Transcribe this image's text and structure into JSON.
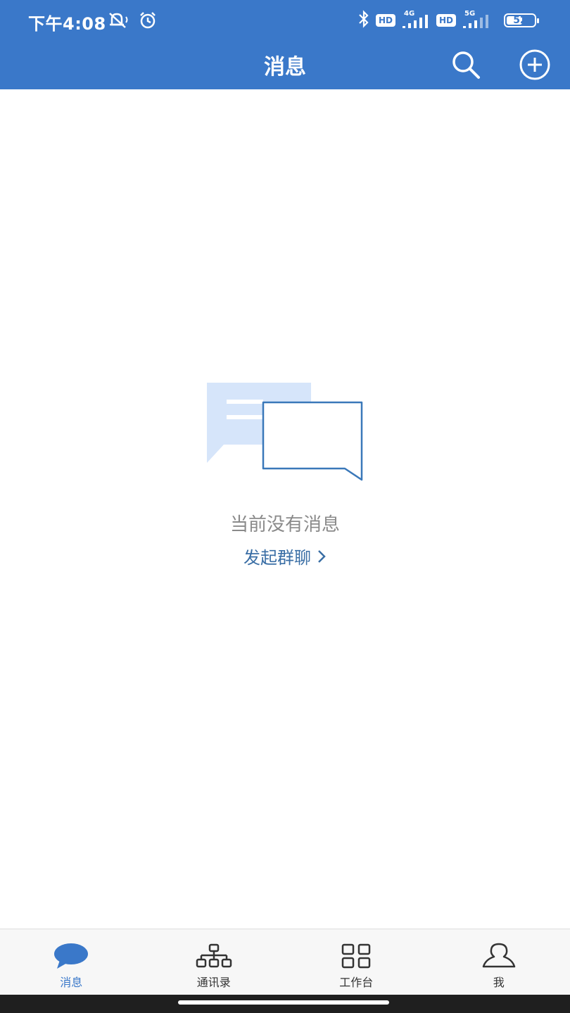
{
  "colors": {
    "brand": "#3a78c9",
    "link": "#3a6ea5",
    "muted_text": "#8a8a8a",
    "illustration_fill": "#d6e5fa"
  },
  "status_bar": {
    "time": "下午4:08",
    "left_icons": [
      "mute-icon",
      "alarm-icon"
    ],
    "right_icons": [
      "bluetooth-icon",
      "hd-icon",
      "signal-icon",
      "hd-icon",
      "signal-icon",
      "battery-icon"
    ],
    "hd_label": "HD",
    "network_1": "4G",
    "network_2": "5G",
    "battery_level": "52"
  },
  "header": {
    "title": "消息",
    "actions": [
      "search-icon",
      "add-circle-icon"
    ]
  },
  "empty_state": {
    "illustration": "chat-bubbles-icon",
    "message": "当前没有消息",
    "action_label": "发起群聊"
  },
  "tabs": [
    {
      "label": "消息",
      "icon": "chat-bubble-icon",
      "active": true
    },
    {
      "label": "通讯录",
      "icon": "org-chart-icon",
      "active": false
    },
    {
      "label": "工作台",
      "icon": "grid-icon",
      "active": false
    },
    {
      "label": "我",
      "icon": "user-icon",
      "active": false
    }
  ]
}
